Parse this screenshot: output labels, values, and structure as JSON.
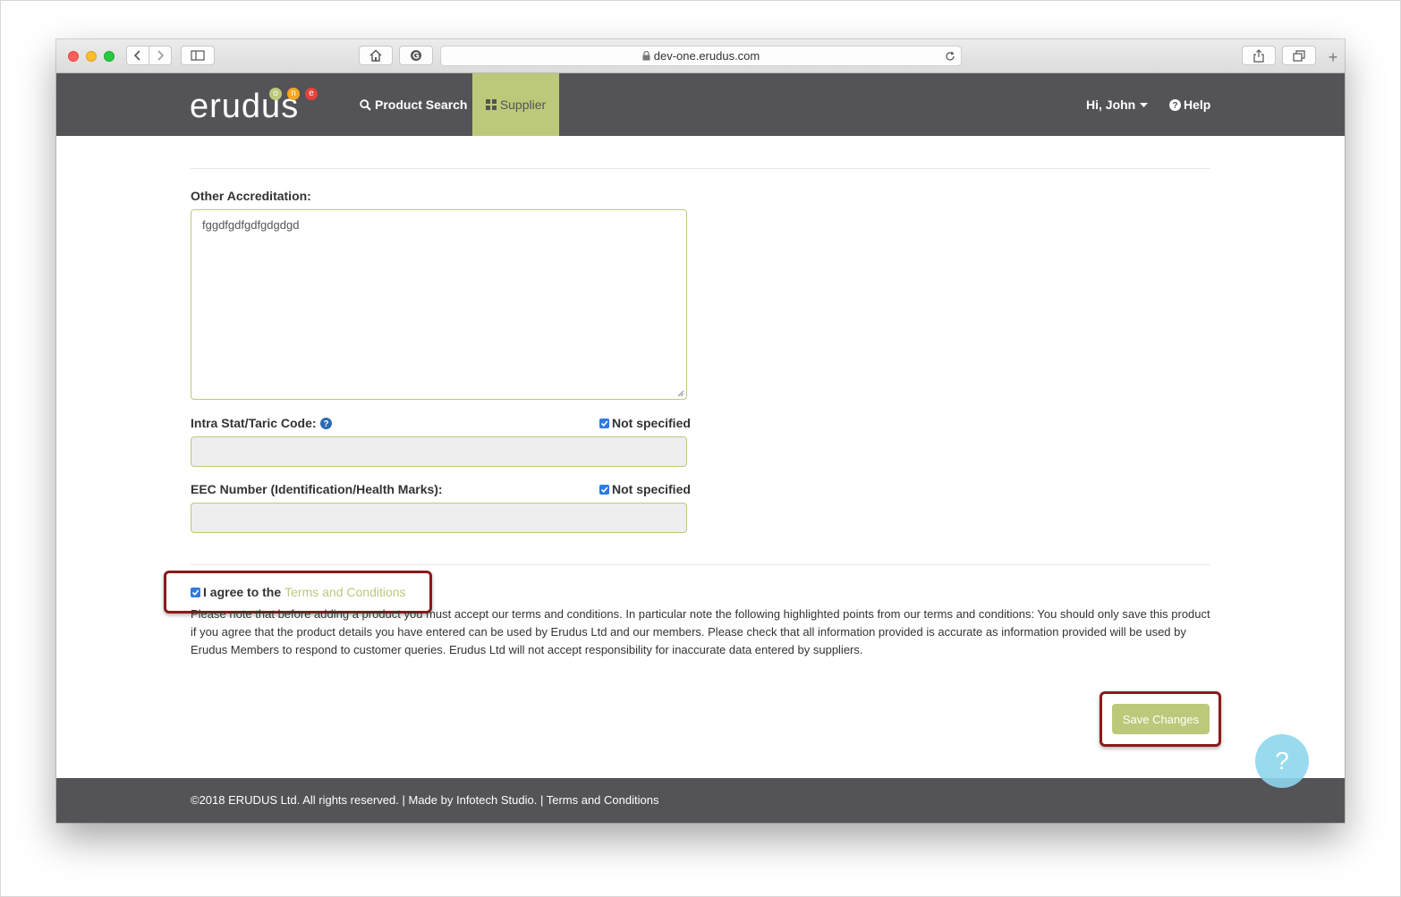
{
  "browser": {
    "url": "dev-one.erudus.com"
  },
  "header": {
    "logo_text": "erudus",
    "logo_letters": [
      "o",
      "n",
      "e"
    ],
    "nav": {
      "product_search": "Product Search",
      "supplier": "Supplier",
      "user": "Hi, John",
      "help": "Help"
    }
  },
  "form": {
    "other_accreditation": {
      "label": "Other Accreditation:",
      "value": "fggdfgdfgdfgdgdgd"
    },
    "intra_stat": {
      "label": "Intra Stat/Taric Code:",
      "not_specified_label": "Not specified",
      "not_specified_checked": true,
      "value": ""
    },
    "eec_number": {
      "label": "EEC Number (Identification/Health Marks):",
      "not_specified_label": "Not specified",
      "not_specified_checked": true,
      "value": ""
    }
  },
  "terms": {
    "checked": true,
    "agree_text": "I agree to the",
    "link_text": "Terms and Conditions",
    "notice": "Please note that before adding a product you must accept our terms and conditions. In particular note the following highlighted points from our terms and conditions: You should only save this product if you agree that the product details you have entered can be used by Erudus Ltd and our members. Please check that all information provided is accurate as information provided will be used by Erudus Members to respond to customer queries. Erudus Ltd will not accept responsibility for inaccurate data entered by suppliers."
  },
  "actions": {
    "save_label": "Save Changes",
    "help_fab": "?"
  },
  "footer": {
    "copyright": "©2018 ERUDUS Ltd. All rights reserved.",
    "made_by": "Made by Infotech Studio.",
    "terms_link": "Terms and Conditions",
    "separator": "|"
  },
  "colors": {
    "accent": "#bcc97a",
    "navbar": "#545357",
    "checkbox": "#2f7be0",
    "highlight": "#8b1a1a"
  },
  "icons": [
    "search-icon",
    "grid-icon",
    "caret-down-icon",
    "question-circle-icon",
    "lock-icon",
    "reload-icon",
    "home-icon",
    "share-icon",
    "tabs-icon",
    "sidebar-icon"
  ]
}
